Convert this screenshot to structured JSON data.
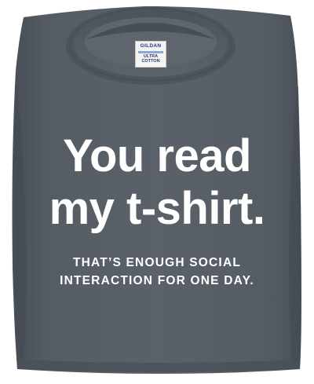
{
  "shirt": {
    "color": "#545b63",
    "headline_line1": "You read",
    "headline_line2": "my t-shirt.",
    "subline_line1": "THAT’S ENOUGH SOCIAL",
    "subline_line2": "INTERACTION FOR ONE DAY.",
    "text_color": "#ffffff"
  },
  "tag": {
    "brand": "GILDAN",
    "line1": "ULTRA",
    "line2": "COTTON"
  }
}
